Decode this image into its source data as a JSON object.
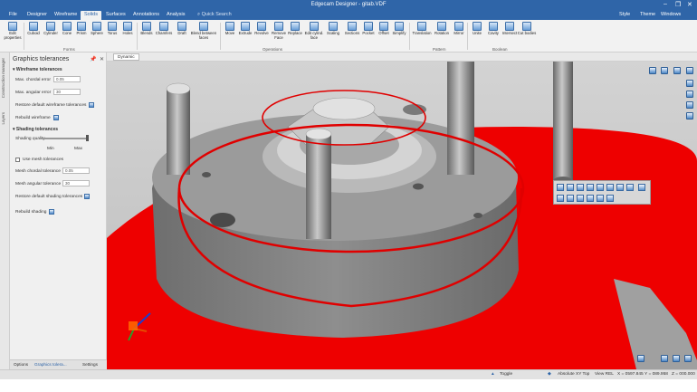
{
  "window": {
    "title": "Edgecam Designer - gitab.VDF",
    "minimize": "–",
    "restore": "❐",
    "close": "✕"
  },
  "tabs": [
    {
      "label": "File"
    },
    {
      "label": "Designer"
    },
    {
      "label": "Wireframe"
    },
    {
      "label": "Solids"
    },
    {
      "label": "Surfaces"
    },
    {
      "label": "Annotations"
    },
    {
      "label": "Analysis"
    }
  ],
  "quick_search": "Quick Search",
  "header_right": {
    "style": "Style",
    "theme": "Theme",
    "windows": "Windows"
  },
  "ribbon": {
    "buttons": [
      {
        "label": "Edit properties"
      },
      {
        "label": "Cuboid"
      },
      {
        "label": "Cylinder"
      },
      {
        "label": "Cone"
      },
      {
        "label": "Prism"
      },
      {
        "label": "Sphere"
      },
      {
        "label": "Torus"
      },
      {
        "label": "Holes"
      },
      {
        "label": "Blends"
      },
      {
        "label": "Chamfers"
      },
      {
        "label": "Draft"
      },
      {
        "label": "Blend between faces"
      },
      {
        "label": "Move"
      },
      {
        "label": "Extrude"
      },
      {
        "label": "Revolve"
      },
      {
        "label": "Remove Face"
      },
      {
        "label": "Replace"
      },
      {
        "label": "Edit cylind. face"
      },
      {
        "label": "Scaling"
      },
      {
        "label": "Sections"
      },
      {
        "label": "Pocket"
      },
      {
        "label": "Offset"
      },
      {
        "label": "Simplify"
      },
      {
        "label": "Translation"
      },
      {
        "label": "Rotation"
      },
      {
        "label": "Mirror"
      },
      {
        "label": "Unite"
      },
      {
        "label": "Cavity"
      },
      {
        "label": "Intersect"
      },
      {
        "label": "Cut bodies"
      }
    ],
    "groups": [
      {
        "label": "Forms"
      },
      {
        "label": "Operations"
      },
      {
        "label": "Pattern"
      },
      {
        "label": "Boolean"
      }
    ]
  },
  "side_tabs": [
    {
      "label": "Construction manager"
    },
    {
      "label": "Layers"
    }
  ],
  "panel": {
    "title": "Graphics tolerances",
    "pin": "📌",
    "close": "✕",
    "wireframe_section": "Wireframe tolerances",
    "max_chordal_error_label": "Max. chordal error",
    "max_chordal_error_value": "0.05",
    "max_angular_error_label": "Max. angular error",
    "max_angular_error_value": "30",
    "restore_wireframe": "Restore default wireframe tolerances",
    "rebuild_wireframe": "Rebuild wireframe",
    "shading_section": "Shading tolerances",
    "shading_quality": "Shading quality",
    "min": "Min",
    "max": "Max",
    "use_mesh": "Use mesh tolerances",
    "mesh_chordal_label": "Mesh chordal tolerance",
    "mesh_chordal_value": "0.05",
    "mesh_angular_label": "Mesh angular tolerance",
    "mesh_angular_value": "30",
    "restore_shading": "Restore default shading tolerances",
    "rebuild_shading": "Rebuild shading"
  },
  "panel_tabs": [
    {
      "label": "Options"
    },
    {
      "label": "Graphics tolera..."
    },
    {
      "label": "Settings"
    }
  ],
  "view_tab": "Dynamic",
  "status": {
    "toggle": "Toggle",
    "absolute": "Absolute XY Top",
    "view": "View REL",
    "x": "X = 0597.845",
    "y": "Y = 089.958",
    "z": "Z = 000.000"
  },
  "colors": {
    "accent": "#2f65a8",
    "model_red": "#ee0000",
    "model_grey": "#8a8a8a"
  }
}
